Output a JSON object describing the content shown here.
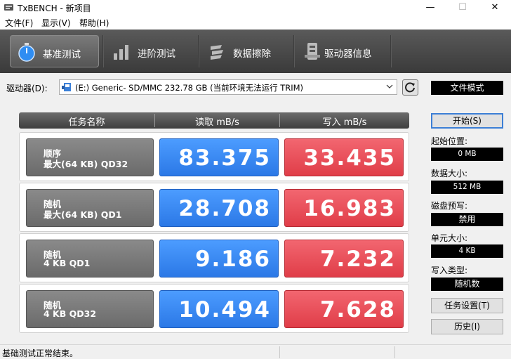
{
  "window": {
    "title": "TxBENCH - 新项目",
    "minimize": "—",
    "maximize": "☐",
    "close": "✕"
  },
  "menu": [
    "文件(F)",
    "显示(V)",
    "帮助(H)"
  ],
  "tabs": [
    {
      "label": "基准测试",
      "icon": "stopwatch-icon",
      "active": true
    },
    {
      "label": "进阶测试",
      "icon": "bar-chart-icon",
      "active": false
    },
    {
      "label": "数据擦除",
      "icon": "eraser-icon",
      "active": false
    },
    {
      "label": "驱动器信息",
      "icon": "drive-info-icon",
      "active": false
    }
  ],
  "drive": {
    "label": "驱动器(D):",
    "selected": "(E:) Generic- SD/MMC  232.78 GB (当前环境无法运行 TRIM)",
    "mode_button": "文件模式"
  },
  "results": {
    "headers": [
      "任务名称",
      "读取 mB/s",
      "写入 mB/s"
    ],
    "rows": [
      {
        "name1": "顺序",
        "name2": "最大(64 KB) QD32",
        "read": "83.375",
        "write": "33.435"
      },
      {
        "name1": "随机",
        "name2": "最大(64 KB) QD1",
        "read": "28.708",
        "write": "16.983"
      },
      {
        "name1": "随机",
        "name2": "4 KB QD1",
        "read": "9.186",
        "write": "7.232"
      },
      {
        "name1": "随机",
        "name2": "4 KB QD32",
        "read": "10.494",
        "write": "7.628"
      }
    ]
  },
  "panel": {
    "start_button": "开始(S)",
    "start_position_label": "起始位置:",
    "start_position_value": "0 MB",
    "data_size_label": "数据大小:",
    "data_size_value": "512 MB",
    "precondition_label": "磁盘预写:",
    "precondition_value": "禁用",
    "unit_size_label": "单元大小:",
    "unit_size_value": "4 KB",
    "write_type_label": "写入类型:",
    "write_type_value": "随机数",
    "task_settings_button": "任务设置(T)",
    "history_button": "历史(I)"
  },
  "status": {
    "text": "基础测试正常结束。"
  },
  "colors": {
    "read": "#3a88f5",
    "write": "#e84e58",
    "header": "#4a4a4a"
  }
}
